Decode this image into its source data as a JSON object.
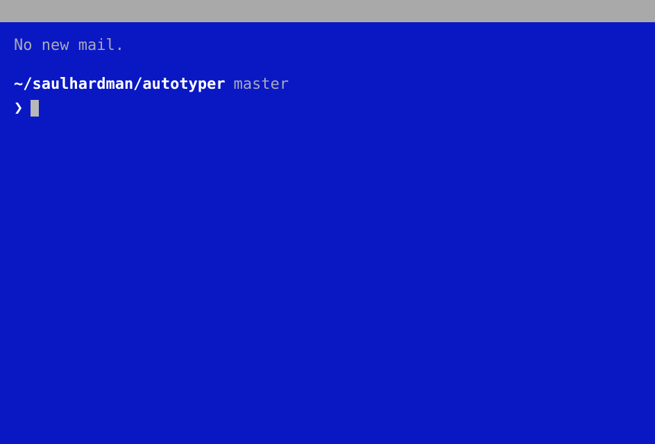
{
  "terminal": {
    "mail_status": "No new mail.",
    "prompt": {
      "path": "~/saulhardman/autotyper",
      "branch": "master",
      "symbol": "❯"
    },
    "input_value": ""
  },
  "colors": {
    "background": "#0a18c4",
    "titlebar": "#a9a9a9",
    "text_muted": "#a9a9b8",
    "text_bright": "#ffffff",
    "cursor": "#b8b8b8"
  }
}
